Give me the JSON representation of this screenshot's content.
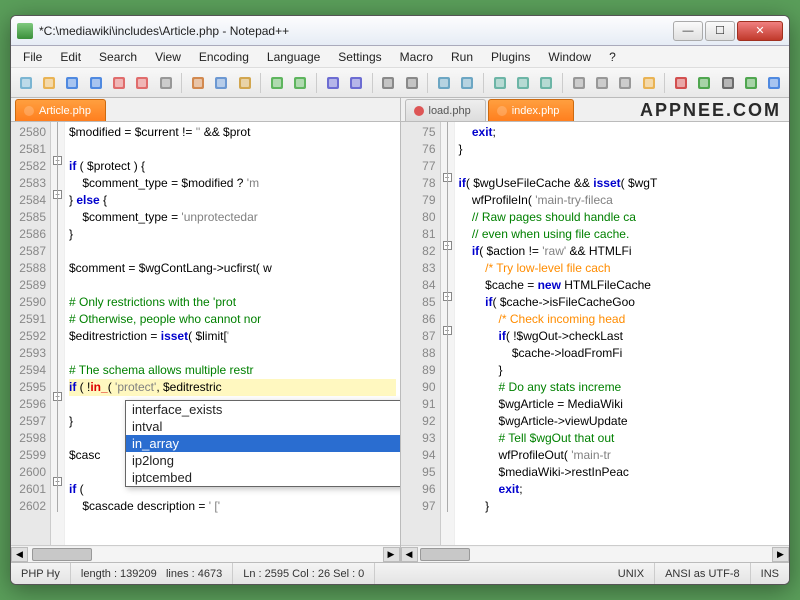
{
  "title": "*C:\\mediawiki\\includes\\Article.php - Notepad++",
  "menu": [
    "File",
    "Edit",
    "Search",
    "View",
    "Encoding",
    "Language",
    "Settings",
    "Macro",
    "Run",
    "Plugins",
    "Window",
    "?"
  ],
  "toolbar_icons": [
    "new-file-icon",
    "open-file-icon",
    "save-icon",
    "save-all-icon",
    "close-icon",
    "close-all-icon",
    "print-icon",
    "sep",
    "cut-icon",
    "copy-icon",
    "paste-icon",
    "sep",
    "undo-icon",
    "redo-icon",
    "sep",
    "find-icon",
    "replace-icon",
    "sep",
    "zoom-in-icon",
    "zoom-out-icon",
    "sep",
    "sync-v-icon",
    "sync-h-icon",
    "sep",
    "wrap-icon",
    "ws-icon",
    "indent-guide-icon",
    "sep",
    "lang-icon",
    "doc-map-icon",
    "func-list-icon",
    "folder-icon",
    "sep",
    "record-icon",
    "play-icon",
    "stop-icon",
    "play-multi-icon",
    "save-macro-icon"
  ],
  "left_tab": {
    "label": "Article.php",
    "modified": true
  },
  "right_tabs": [
    {
      "label": "load.php",
      "active": false
    },
    {
      "label": "index.php",
      "active": true
    }
  ],
  "left_gutter_start": 2580,
  "left_gutter_end": 2602,
  "left_lines": [
    {
      "n": 2580,
      "html": "<span class='k-var'>$modified</span> = <span class='k-var'>$current</span> != <span class='k-gray'>''</span> && <span class='k-var'>$prot</span>"
    },
    {
      "n": 2581,
      "html": ""
    },
    {
      "n": 2582,
      "html": "<span class='k-blue'>if</span> ( <span class='k-var'>$protect</span> ) {"
    },
    {
      "n": 2583,
      "html": "    <span class='k-var'>$comment_type</span> = <span class='k-var'>$modified</span> ? <span class='k-gray'>'m</span>"
    },
    {
      "n": 2584,
      "html": "} <span class='k-blue'>else</span> {"
    },
    {
      "n": 2585,
      "html": "    <span class='k-var'>$comment_type</span> = <span class='k-gray'>'unprotectedar</span>"
    },
    {
      "n": 2586,
      "html": "}"
    },
    {
      "n": 2587,
      "html": ""
    },
    {
      "n": 2588,
      "html": "<span class='k-var'>$comment</span> = <span class='k-var'>$wgContLang</span>->ucfirst( w"
    },
    {
      "n": 2589,
      "html": ""
    },
    {
      "n": 2590,
      "html": "<span class='k-comm'># Only restrictions with the 'prot</span>"
    },
    {
      "n": 2591,
      "html": "<span class='k-comm'># Otherwise, people who cannot nor</span>"
    },
    {
      "n": 2592,
      "html": "<span class='k-var'>$editrestriction</span> = <span class='k-blue'>isset</span>( <span class='k-var'>$limit</span>[<span class='k-gray'>'</span>"
    },
    {
      "n": 2593,
      "html": ""
    },
    {
      "n": 2594,
      "html": "<span class='k-comm'># The schema allows multiple restr</span>"
    },
    {
      "n": 2595,
      "html": "<span class='hl'><span class='k-blue'>if</span> ( !<span class='caret-red'>in_</span>( <span class='k-gray'>'protect'</span>, <span class='k-var'>$editrestric</span></span>"
    },
    {
      "n": 2596,
      "html": ""
    },
    {
      "n": 2597,
      "html": "}"
    },
    {
      "n": 2598,
      "html": ""
    },
    {
      "n": 2599,
      "html": "<span class='k-var'>$casc</span>"
    },
    {
      "n": 2600,
      "html": ""
    },
    {
      "n": 2601,
      "html": "<span class='k-blue'>if</span> ("
    },
    {
      "n": 2602,
      "html": "    <span class='k-var'>$cascade description</span> = <span class='k-gray'>' ['</span>"
    }
  ],
  "right_gutter": [
    75,
    76,
    77,
    78,
    79,
    80,
    81,
    82,
    83,
    84,
    85,
    86,
    87,
    88,
    89,
    90,
    91,
    92,
    93,
    94,
    95,
    96,
    97
  ],
  "right_lines": [
    {
      "html": "    <span class='k-blue'>exit</span>;"
    },
    {
      "html": "}"
    },
    {
      "html": ""
    },
    {
      "html": "<span class='k-blue'>if</span>( <span class='k-var'>$wgUseFileCache</span> && <span class='k-blue'>isset</span>( <span class='k-var'>$wgT</span>"
    },
    {
      "html": "    wfProfileIn( <span class='k-gray'>'main-try-fileca</span>"
    },
    {
      "html": "    <span class='k-comm'>// Raw pages should handle ca</span>"
    },
    {
      "html": "    <span class='k-comm'>// even when using file cache.</span>"
    },
    {
      "html": "    <span class='k-blue'>if</span>( <span class='k-var'>$action</span> != <span class='k-gray'>'raw'</span> && HTMLFi"
    },
    {
      "html": "        <span class='k-comm2'>/* Try low-level file cach</span>"
    },
    {
      "html": "        <span class='k-var'>$cache</span> = <span class='k-blue'>new</span> HTMLFileCache"
    },
    {
      "html": "        <span class='k-blue'>if</span>( <span class='k-var'>$cache</span>->isFileCacheGoo"
    },
    {
      "html": "            <span class='k-comm2'>/* Check incoming head</span>"
    },
    {
      "html": "            <span class='k-blue'>if</span>( !<span class='k-var'>$wgOut</span>->checkLast"
    },
    {
      "html": "                <span class='k-var'>$cache</span>->loadFromFi"
    },
    {
      "html": "            }"
    },
    {
      "html": "            <span class='k-comm'># Do any stats increme</span>"
    },
    {
      "html": "            <span class='k-var'>$wgArticle</span> = MediaWiki"
    },
    {
      "html": "            <span class='k-var'>$wgArticle</span>->viewUpdate"
    },
    {
      "html": "            <span class='k-comm'># Tell $wgOut that out</span>"
    },
    {
      "html": "            wfProfileOut( <span class='k-gray'>'main-tr</span>"
    },
    {
      "html": "            <span class='k-var'>$mediaWiki</span>->restInPeac"
    },
    {
      "html": "            <span class='k-blue'>exit</span>;"
    },
    {
      "html": "        }"
    }
  ],
  "autocomplete": {
    "items": [
      "interface_exists",
      "intval",
      "in_array",
      "ip2long",
      "iptcembed"
    ],
    "selected_index": 2
  },
  "status": {
    "lang": "PHP Hy",
    "length": "length : 139209",
    "lines": "lines : 4673",
    "pos": "Ln : 2595   Col : 26   Sel : 0",
    "eol": "UNIX",
    "enc": "ANSI as UTF-8",
    "mode": "INS"
  },
  "watermark": "APPNEE.COM"
}
